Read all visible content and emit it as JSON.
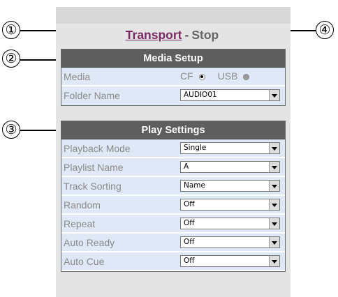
{
  "callouts": [
    "①",
    "②",
    "③",
    "④"
  ],
  "title": {
    "transport_link": "Transport",
    "separator": "-",
    "stop": "Stop"
  },
  "media_setup": {
    "header": "Media Setup",
    "media_label": "Media",
    "media_options": [
      {
        "label": "CF",
        "selected": true
      },
      {
        "label": "USB",
        "selected": false
      }
    ],
    "folder_label": "Folder Name",
    "folder_value": "AUDIO01"
  },
  "play_settings": {
    "header": "Play Settings",
    "rows": [
      {
        "label": "Playback Mode",
        "value": "Single"
      },
      {
        "label": "Playlist Name",
        "value": "A"
      },
      {
        "label": "Track Sorting",
        "value": "Name"
      },
      {
        "label": "Random",
        "value": "Off"
      },
      {
        "label": "Repeat",
        "value": "Off"
      },
      {
        "label": "Auto Ready",
        "value": "Off"
      },
      {
        "label": "Auto Cue",
        "value": "Off"
      }
    ]
  }
}
